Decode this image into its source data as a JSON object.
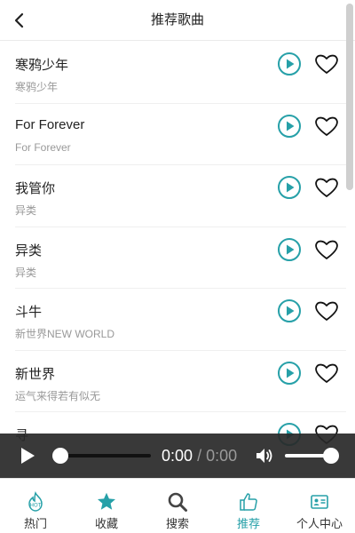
{
  "header": {
    "title": "推荐歌曲"
  },
  "songs": [
    {
      "title": "寒鸦少年",
      "subtitle": "寒鸦少年"
    },
    {
      "title": "For Forever",
      "subtitle": "For Forever"
    },
    {
      "title": "我管你",
      "subtitle": "异类"
    },
    {
      "title": "异类",
      "subtitle": "异类"
    },
    {
      "title": "斗牛",
      "subtitle": "新世界NEW WORLD"
    },
    {
      "title": "新世界",
      "subtitle": "运气来得若有似无"
    },
    {
      "title": "寻",
      "subtitle": ""
    }
  ],
  "player": {
    "current_time": "0:00",
    "separator": "/",
    "duration": "0:00",
    "progress": 0,
    "volume": 1
  },
  "tabs": [
    {
      "label": "热门",
      "icon": "hot-icon"
    },
    {
      "label": "收藏",
      "icon": "star-icon"
    },
    {
      "label": "搜索",
      "icon": "search-icon"
    },
    {
      "label": "推荐",
      "icon": "thumbs-up-icon",
      "active": true
    },
    {
      "label": "个人中心",
      "icon": "profile-card-icon"
    }
  ],
  "colors": {
    "accent": "#26a0a8",
    "player_bg": "#282828",
    "text": "#222222",
    "subtext": "#999999"
  }
}
